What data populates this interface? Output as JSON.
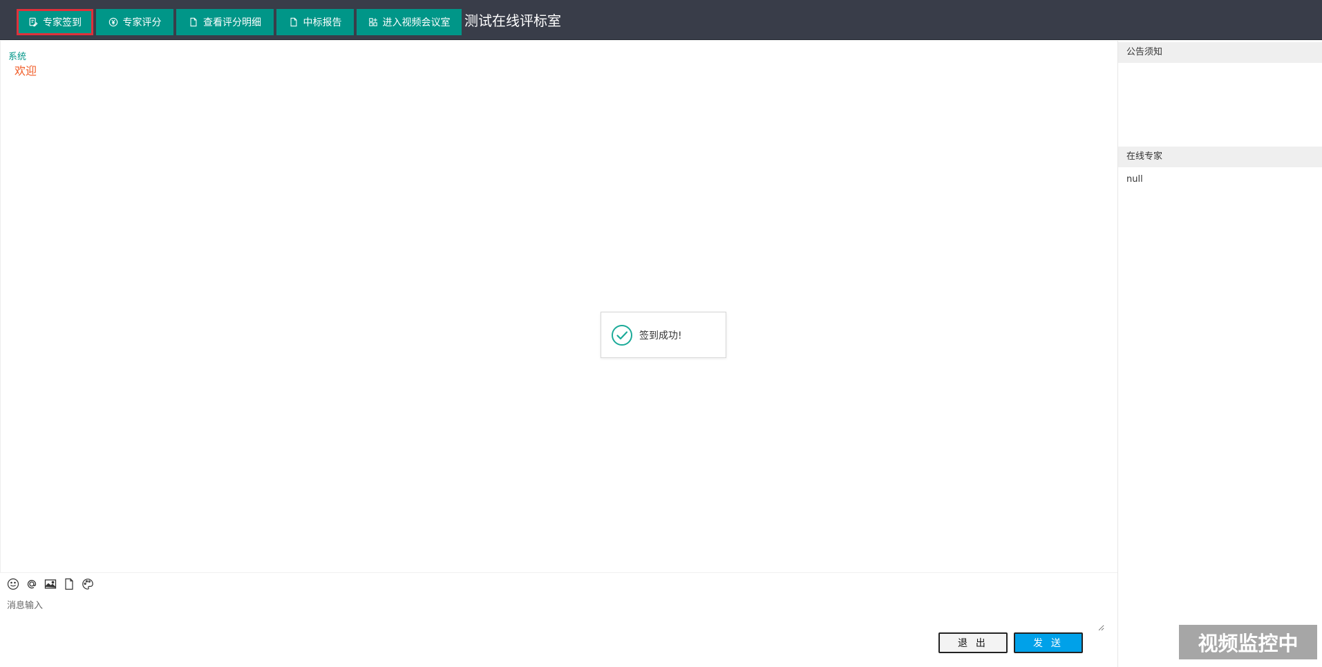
{
  "toolbar": {
    "buttons": [
      {
        "label": "专家签到",
        "icon": "sign-in-icon"
      },
      {
        "label": "专家评分",
        "icon": "yen-icon"
      },
      {
        "label": "查看评分明细",
        "icon": "document-icon"
      },
      {
        "label": "中标报告",
        "icon": "document-icon"
      },
      {
        "label": "进入视频会议室",
        "icon": "apps-icon"
      }
    ],
    "selected_index": 0,
    "room_title": "测试在线评标室"
  },
  "chat": {
    "messages": [
      {
        "sender": "系统",
        "text": "欢迎"
      }
    ]
  },
  "toast": {
    "text": "签到成功!",
    "icon": "success-check-icon"
  },
  "sidebar": {
    "notice_title": "公告须知",
    "online_title": "在线专家",
    "online_experts": [
      "null"
    ]
  },
  "input": {
    "tools": [
      "emoji-icon",
      "at-icon",
      "image-icon",
      "file-icon",
      "palette-icon"
    ],
    "placeholder": "消息输入",
    "exit_label": "退 出",
    "send_label": "发 送"
  },
  "badge": {
    "text": "视频监控中"
  },
  "colors": {
    "topbar": "#393d49",
    "button": "#009688",
    "selected_border": "#e0313b",
    "sender": "#009688",
    "message": "#f05a24",
    "send_button": "#00a1e9",
    "badge": "#a6a6a6"
  }
}
